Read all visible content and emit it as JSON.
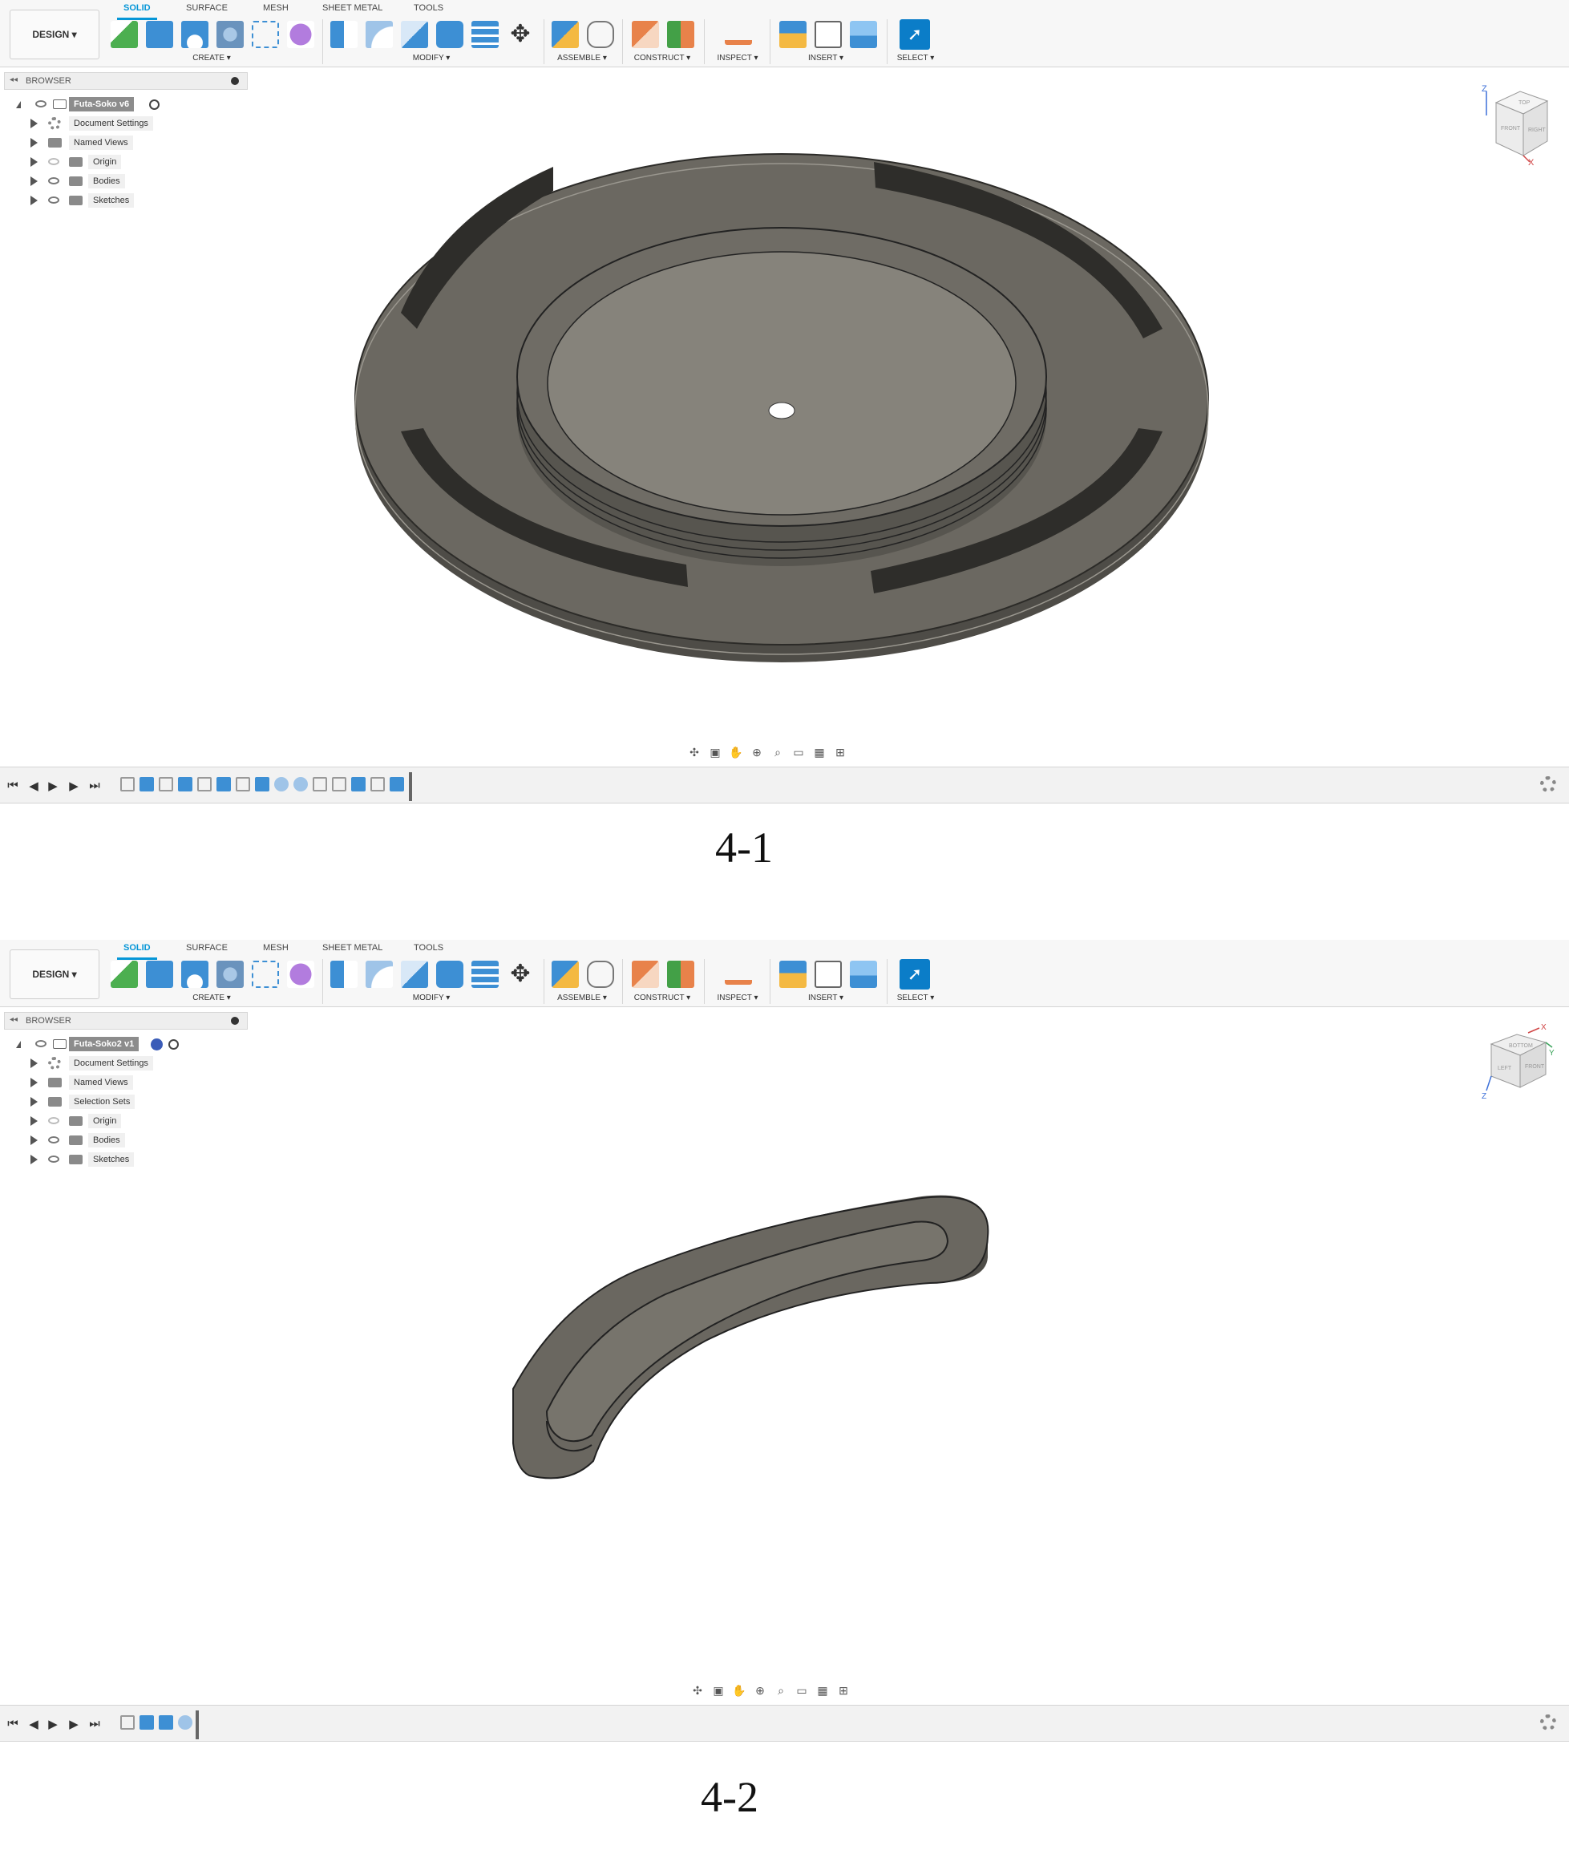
{
  "panels": [
    {
      "toolbar": {
        "workspace_label": "DESIGN ▾",
        "tabs": [
          "SOLID",
          "SURFACE",
          "MESH",
          "SHEET METAL",
          "TOOLS"
        ],
        "groups": [
          "CREATE ▾",
          "MODIFY ▾",
          "ASSEMBLE ▾",
          "CONSTRUCT ▾",
          "INSPECT ▾",
          "INSERT ▾",
          "SELECT ▾"
        ]
      },
      "browser": {
        "title": "BROWSER",
        "root": "Futa-Soko v6",
        "items": [
          "Document Settings",
          "Named Views",
          "Origin",
          "Bodies",
          "Sketches"
        ]
      },
      "viewcube": {
        "faces": [
          "TOP",
          "FRONT",
          "RIGHT"
        ],
        "axes": [
          "Z",
          "X"
        ]
      },
      "caption": "4-1"
    },
    {
      "toolbar": {
        "workspace_label": "DESIGN ▾",
        "tabs": [
          "SOLID",
          "SURFACE",
          "MESH",
          "SHEET METAL",
          "TOOLS"
        ],
        "groups": [
          "CREATE ▾",
          "MODIFY ▾",
          "ASSEMBLE ▾",
          "CONSTRUCT ▾",
          "INSPECT ▾",
          "INSERT ▾",
          "SELECT ▾"
        ]
      },
      "browser": {
        "title": "BROWSER",
        "root": "Futa-Soko2 v1",
        "items": [
          "Document Settings",
          "Named Views",
          "Selection Sets",
          "Origin",
          "Bodies",
          "Sketches"
        ]
      },
      "viewcube": {
        "faces": [
          "BOTTOM",
          "LEFT",
          "FRONT"
        ],
        "axes": [
          "X",
          "Y",
          "Z"
        ]
      },
      "caption": "4-2"
    }
  ],
  "colors": {
    "accent": "#0696d7",
    "model": "#6b6860",
    "model_top": "#75726a",
    "background": "#ffffff"
  }
}
